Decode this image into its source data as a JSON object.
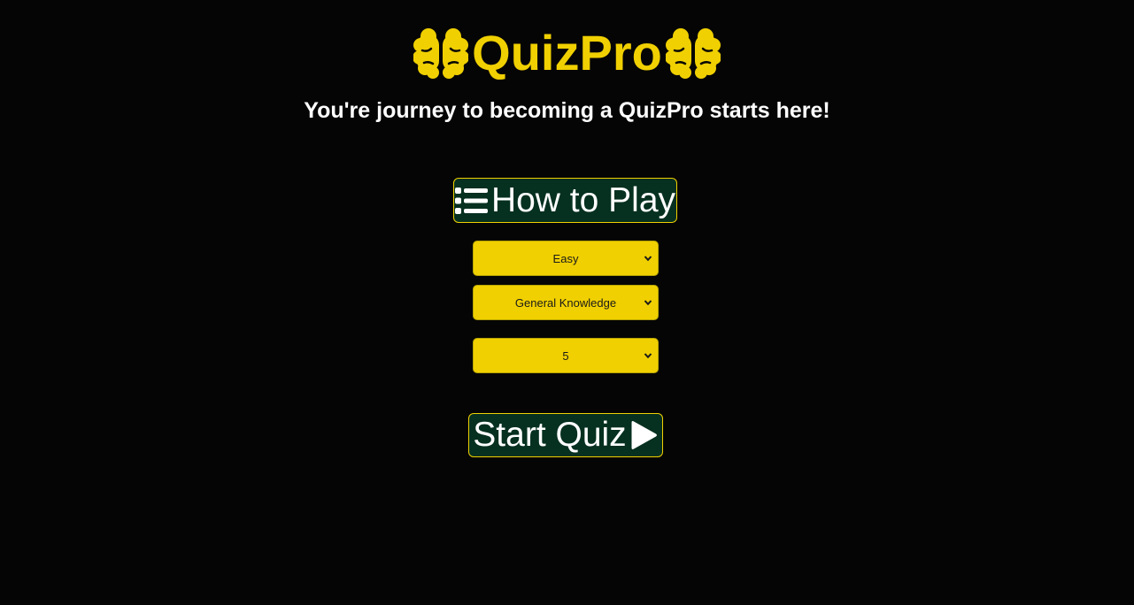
{
  "app": {
    "title": "QuizPro",
    "tagline": "You're journey to becoming a QuizPro starts here!"
  },
  "colors": {
    "background": "#050505",
    "accent": "#f0d000",
    "button_bg": "#063020",
    "text": "#ffffff"
  },
  "icons": {
    "left_logo": "brain-icon",
    "right_logo": "brain-icon",
    "how_to_play": "list-icon",
    "start": "play-icon",
    "dropdown": "chevron-down-icon"
  },
  "buttons": {
    "how_to_play_label": "How to Play",
    "start_label": "Start Quiz"
  },
  "selects": {
    "difficulty": "Easy",
    "category": "General Knowledge",
    "question_count": "5"
  }
}
